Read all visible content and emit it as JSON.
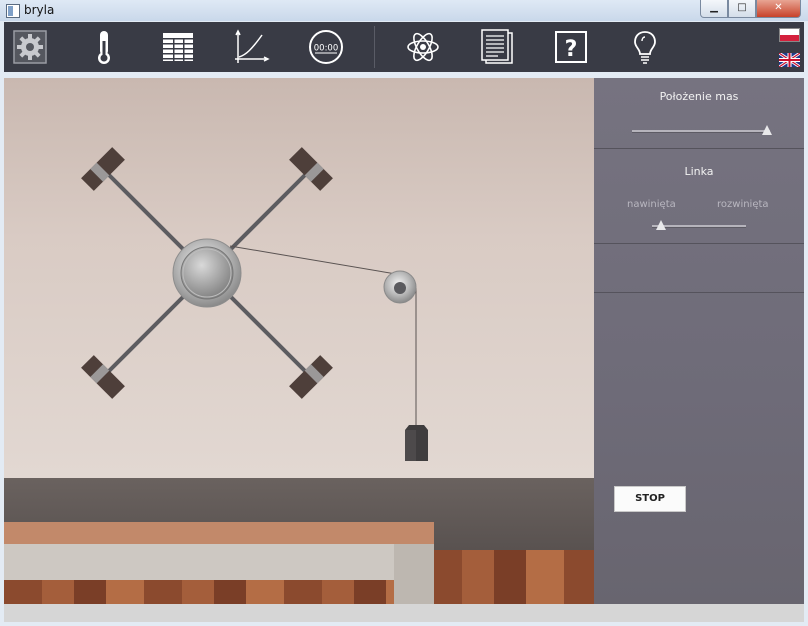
{
  "window": {
    "title": "bryla",
    "min_label": "▁",
    "max_label": "□",
    "close_label": "✕"
  },
  "toolbar": {
    "icons": [
      "gear-icon",
      "thermometer-icon",
      "table-icon",
      "graph-icon",
      "timer-icon",
      "atom-icon",
      "document-icon",
      "help-icon",
      "lightbulb-icon"
    ],
    "timer_text": "00:00",
    "help_text": "?",
    "languages": [
      "pl",
      "en"
    ]
  },
  "panel": {
    "mass_position": {
      "label": "Położenie mas",
      "value": 0.98
    },
    "string": {
      "label": "Linka",
      "left_label": "nawinięta",
      "right_label": "rozwinięta",
      "value": 0.1
    },
    "stop_label": "STOP"
  }
}
